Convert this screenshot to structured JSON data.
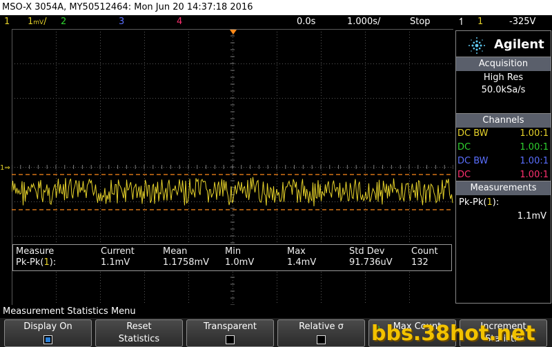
{
  "titlebar": {
    "text": "MSO-X 3054A, MY50512464: Mon Jun 20 14:37:18 2016"
  },
  "status": {
    "ch1": "1",
    "ch1_scale": "1",
    "ch1_unit": "/",
    "ch2": "2",
    "ch3": "3",
    "ch4": "4",
    "time_pos": "0.0s",
    "time_scale": "1.000s/",
    "run_state": "Stop",
    "trigger_icon": "trigger-edge-icon",
    "trigger_src": "1",
    "trigger_level": "-325V"
  },
  "colors": {
    "ch1": "#e6d22a",
    "ch2": "#2fd22f",
    "ch3": "#5a6fff",
    "ch4": "#ff2f6f",
    "grid": "#5a5a5a",
    "cursor": "#ff8a1a"
  },
  "measurement_table": {
    "headers": [
      "Measure",
      "Current",
      "Mean",
      "Min",
      "Max",
      "Std Dev",
      "Count"
    ],
    "row_label": "Pk-Pk(",
    "row_ch": "1",
    "row_close": "):",
    "values": [
      "1.1mV",
      "1.1758mV",
      "1.0mV",
      "1.4mV",
      "91.736uV",
      "132"
    ]
  },
  "brand": {
    "name": "Agilent"
  },
  "acquisition": {
    "header": "Acquisition",
    "mode": "High Res",
    "rate": "50.0kSa/s"
  },
  "channels": {
    "header": "Channels",
    "rows": [
      {
        "coupling": "DC BW",
        "probe": "1.00:1"
      },
      {
        "coupling": "DC",
        "probe": "1.00:1"
      },
      {
        "coupling": "DC BW",
        "probe": "1.00:1"
      },
      {
        "coupling": "DC",
        "probe": "1.00:1"
      }
    ]
  },
  "measurements": {
    "header": "Measurements",
    "item": "Pk-Pk(",
    "item_ch": "1",
    "item_close": "):",
    "value": "1.1mV"
  },
  "menu": {
    "title": "Measurement Statistics Menu"
  },
  "softkeys": [
    {
      "label": "Display On",
      "checkbox": true,
      "checked": true
    },
    {
      "label": "Reset",
      "label2": "Statistics"
    },
    {
      "label": "Transparent",
      "checkbox": true,
      "checked": false
    },
    {
      "label": "Relative σ",
      "checkbox": true,
      "checked": false
    },
    {
      "label": "Max Count",
      "label2": ""
    },
    {
      "label": "Increment",
      "label2": "Statistic"
    }
  ],
  "watermark": "bbs.38hot.net"
}
